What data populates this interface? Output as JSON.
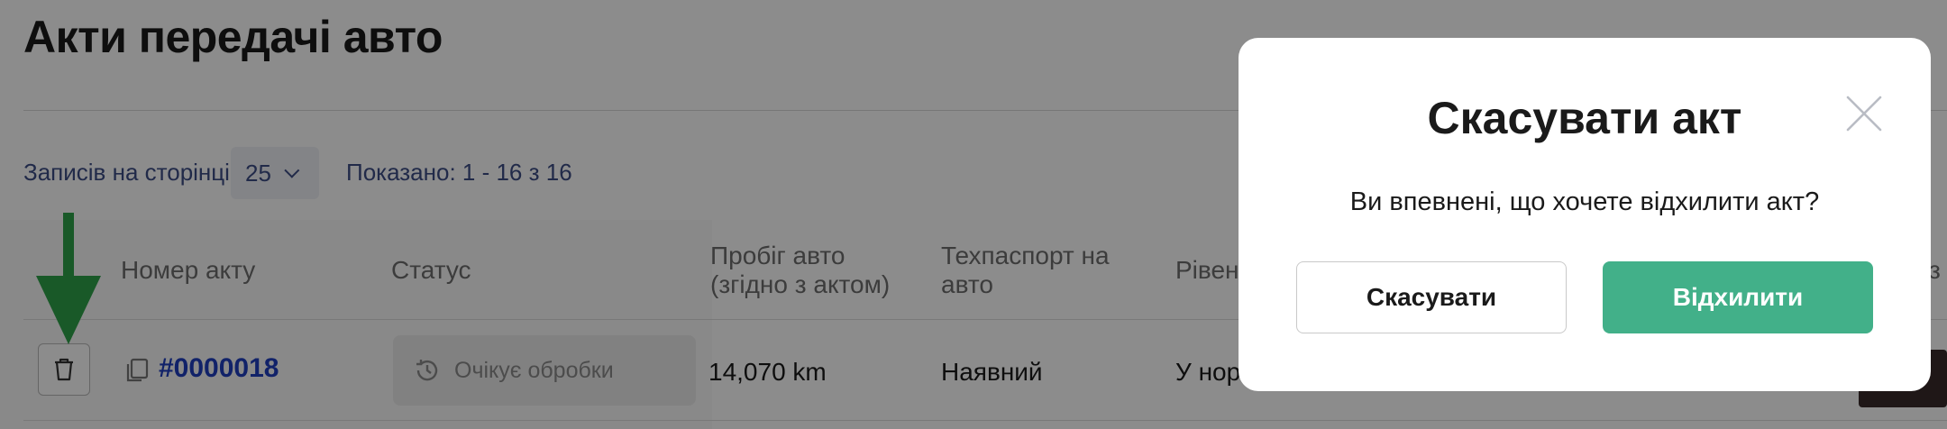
{
  "page": {
    "title": "Акти передачі авто",
    "per_page_label": "Записів на сторінці",
    "per_page_value": "25",
    "shown_text": "Показано: 1 - 16 з 16"
  },
  "table": {
    "headers": {
      "act_number": "Номер акту",
      "status": "Статус",
      "mileage_line1": "Пробіг авто",
      "mileage_line2": "(згідно з актом)",
      "techpassport_line1": "Техпаспорт на",
      "techpassport_line2": "авто",
      "level": "Рівен",
      "extra": "з"
    },
    "rows": [
      {
        "act_number": "#0000018",
        "status": "Очікує обробки",
        "mileage": "14,070 km",
        "techpassport": "Наявний",
        "level": "У нор"
      }
    ]
  },
  "modal": {
    "title": "Скасувати акт",
    "message": "Ви впевнені, що хочете відхилити акт?",
    "cancel_label": "Скасувати",
    "reject_label": "Відхилити"
  },
  "colors": {
    "accent_green": "#42b089",
    "link_blue": "#1f3fbf",
    "arrow_green": "#2fa24a"
  },
  "icons": [
    "trash-icon",
    "copy-icon",
    "history-icon",
    "close-icon",
    "chevron-down-icon",
    "arrow-down-icon"
  ]
}
